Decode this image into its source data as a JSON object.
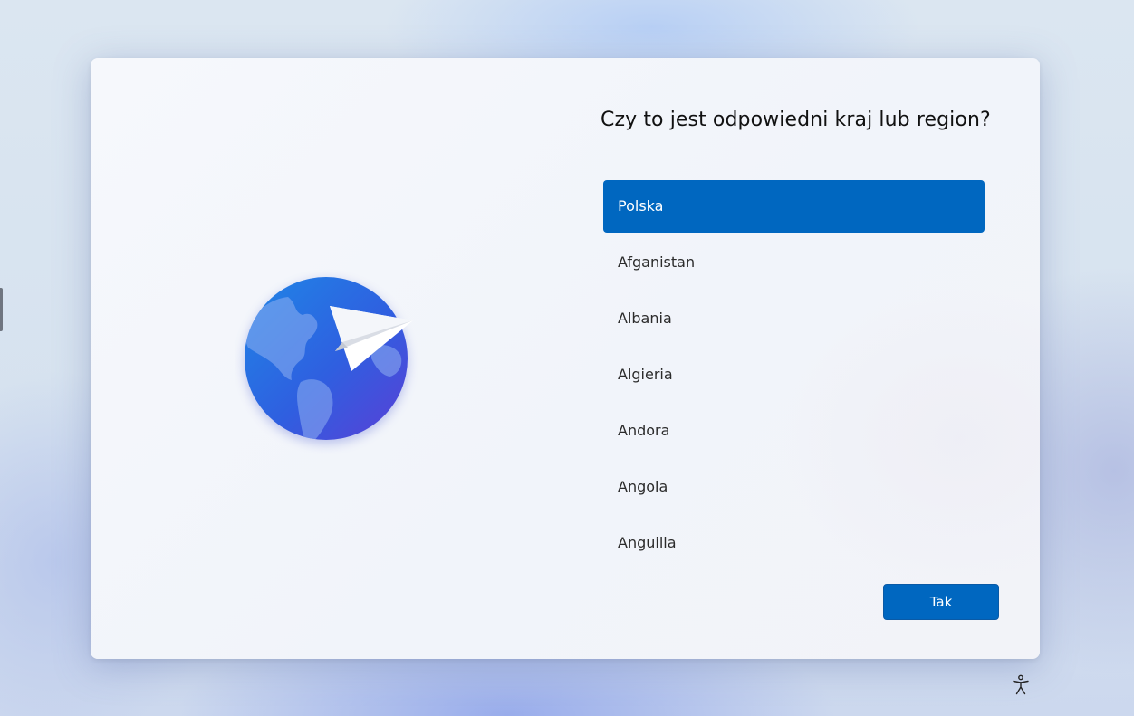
{
  "dialog": {
    "title": "Czy to jest odpowiedni kraj lub region?",
    "selected_country": "Polska",
    "countries": [
      "Polska",
      "Afganistan",
      "Albania",
      "Algieria",
      "Andora",
      "Angola",
      "Anguilla"
    ],
    "confirm_label": "Tak"
  },
  "icons": {
    "illustration": "globe-with-paper-plane-icon",
    "accessibility": "accessibility-icon"
  },
  "colors": {
    "accent": "#0067c0",
    "selected_text": "#ffffff",
    "title_text": "#111111",
    "item_text": "#2b2b2b"
  }
}
